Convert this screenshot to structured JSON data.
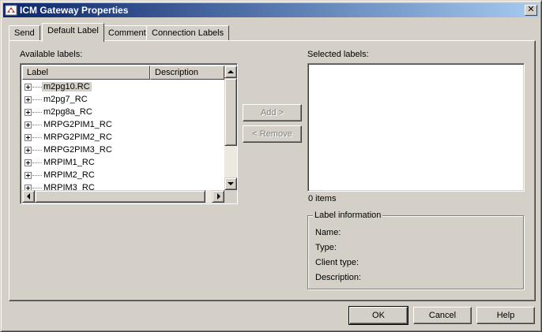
{
  "window": {
    "title": "ICM Gateway Properties",
    "close_glyph": "✕",
    "app_icon": "icm-app-icon"
  },
  "tabs": [
    {
      "label": "Send",
      "active": false
    },
    {
      "label": "Default Label",
      "active": true
    },
    {
      "label": "Comment",
      "active": false
    },
    {
      "label": "Connection Labels",
      "active": false
    }
  ],
  "available": {
    "caption": "Available labels:",
    "columns": [
      "Label",
      "Description"
    ],
    "items": [
      "m2pg10.RC",
      "m2pg7_RC",
      "m2pg8a_RC",
      "MRPG2PIM1_RC",
      "MRPG2PIM2_RC",
      "MRPG2PIM3_RC",
      "MRPIM1_RC",
      "MRPIM2_RC",
      "MRPIM3_RC"
    ],
    "selected_index": 0
  },
  "actions": {
    "add_label": "Add >",
    "remove_label": "< Remove"
  },
  "selected": {
    "caption": "Selected labels:",
    "count_text": "0 items"
  },
  "label_info": {
    "title": "Label information",
    "fields": [
      "Name:",
      "Type:",
      "Client type:",
      "Description:"
    ]
  },
  "footer": {
    "ok_label": "OK",
    "cancel_label": "Cancel",
    "help_label": "Help"
  },
  "colors": {
    "face": "#d4d0c8",
    "titlebar_start": "#0a246a",
    "titlebar_end": "#a6caf0"
  }
}
